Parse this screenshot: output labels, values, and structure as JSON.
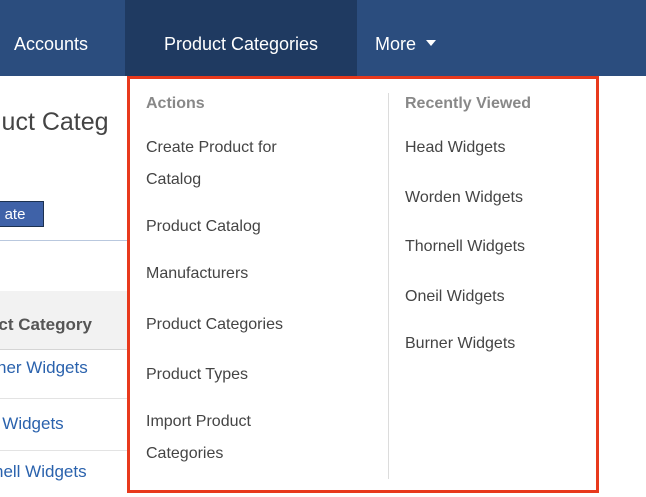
{
  "nav": {
    "accounts": "Accounts",
    "product_categories": "Product Categories",
    "more": "More"
  },
  "page": {
    "title": "luct Categ",
    "button": "ate",
    "column_header": "uct Category",
    "rows": [
      "ner Widgets",
      "il Widgets",
      "nell Widgets"
    ]
  },
  "dropdown": {
    "actions_header": "Actions",
    "recent_header": "Recently Viewed",
    "actions": [
      {
        "line1": "Create Product for",
        "line2": "Catalog"
      },
      {
        "line1": "Product Catalog"
      },
      {
        "line1": "Manufacturers"
      },
      {
        "line1": "Product Categories"
      },
      {
        "line1": "Product Types"
      },
      {
        "line1": "Import Product",
        "line2": "Categories"
      }
    ],
    "recent": [
      "Head Widgets",
      "Worden Widgets",
      "Thornell Widgets",
      "Oneil Widgets",
      "Burner Widgets"
    ]
  },
  "colors": {
    "nav_bg": "#2b4d7e",
    "nav_active_bg": "#1f3a61",
    "highlight_border": "#e8391c",
    "link": "#2a62ad"
  }
}
